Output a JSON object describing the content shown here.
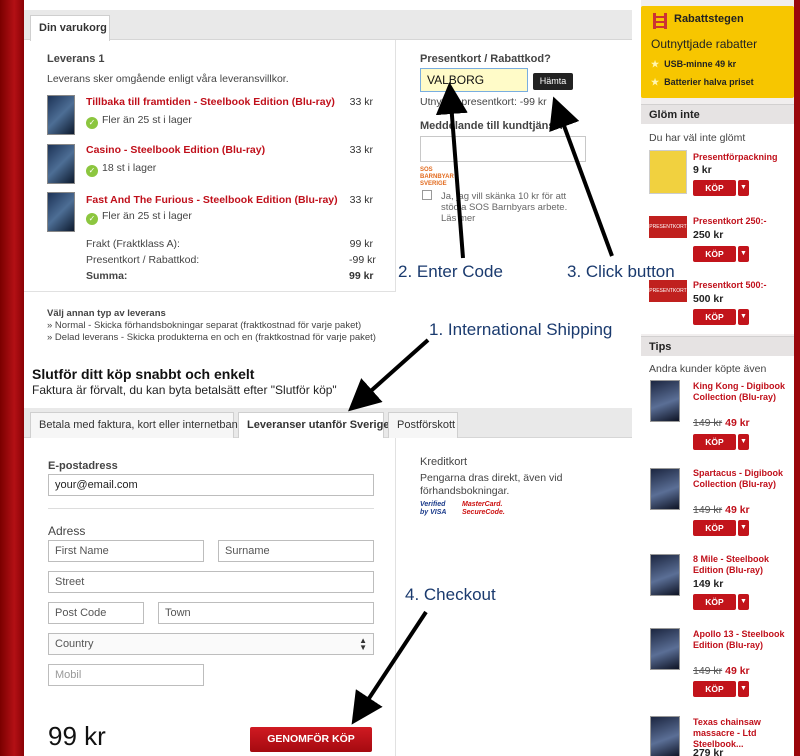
{
  "cart": {
    "tab_label": "Din varukorg",
    "delivery_heading": "Leverans 1",
    "delivery_note": "Leverans sker omgående enligt våra leveransvillkor.",
    "items": [
      {
        "title": "Tillbaka till framtiden - Steelbook Edition (Blu-ray)",
        "stock": "Fler än 25 st i lager",
        "price": "33 kr"
      },
      {
        "title": "Casino - Steelbook Edition (Blu-ray)",
        "stock": "18 st i lager",
        "price": "33 kr"
      },
      {
        "title": "Fast And The Furious - Steelbook Edition (Blu-ray)",
        "stock": "Fler än 25 st i lager",
        "price": "33 kr"
      }
    ],
    "freight_label": "Frakt (Fraktklass A):",
    "freight_value": "99 kr",
    "giftcard_label": "Presentkort / Rabattkod:",
    "giftcard_value": "-99 kr",
    "sum_label": "Summa:",
    "sum_value": "99 kr"
  },
  "delivery_options": {
    "heading": "Välj annan typ av leverans",
    "option1": "» Normal - Skicka förhandsbokningar separat (fraktkostnad för varje paket)",
    "option2": "» Delad leverans - Skicka produkterna en och en (fraktkostnad för varje paket)"
  },
  "discount": {
    "label": "Presentkort / Rabattkod?",
    "code_value": "VALBORG",
    "fetch_label": "Hämta",
    "used_text": "Utnyttjat presentkort: -99 kr",
    "message_label": "Meddelande till kundtjänst?",
    "sos_logo": "SOS BARNBYAR SVERIGE",
    "donate_text_1": "Ja, jag vill skänka 10 kr för att",
    "donate_text_2": "stödja SOS Barnbyars arbete.",
    "donate_text_3": "Läs mer"
  },
  "checkout": {
    "title": "Slutför ditt köp snabbt och enkelt",
    "subtitle": "Faktura är förvalt, du kan byta betalsätt efter \"Slutför köp\"",
    "tabs": [
      "Betala med faktura, kort eller internetbank",
      "Leveranser utanför Sverige",
      "Postförskott"
    ],
    "email_label": "E-postadress",
    "email_value": "your@email.com",
    "address_label": "Adress",
    "first_name": "First Name",
    "surname": "Surname",
    "street": "Street",
    "post_code": "Post Code",
    "town": "Town",
    "country": "Country",
    "mobile": "Mobil",
    "total": "99 kr",
    "button": "GENOMFÖR KÖP"
  },
  "card": {
    "heading": "Kreditkort",
    "text_1": "Pengarna dras direkt, även vid",
    "text_2": "förhandsbokningar.",
    "visa": "Verified by VISA",
    "mastercard": "MasterCard. SecureCode."
  },
  "sidebar": {
    "promo_title": "Rabattstegen",
    "promo_sub": "Outnyttjade rabatter",
    "promo_items": [
      "USB-minne 49 kr",
      "Batterier halva priset"
    ],
    "forget_head": "Glöm inte",
    "forget_sub": "Du har väl inte glömt",
    "forget_items": [
      {
        "name": "Presentförpackning",
        "price": "9 kr",
        "thumb": ""
      },
      {
        "name": "Presentkort 250:-",
        "price": "250 kr",
        "thumb": "PRESENTKORT"
      },
      {
        "name": "Presentkort 500:-",
        "price": "500 kr",
        "thumb": "PRESENTKORT"
      }
    ],
    "tips_head": "Tips",
    "tips_sub": "Andra kunder köpte även",
    "tips_items": [
      {
        "name": "King Kong - Digibook Collection (Blu-ray)",
        "old": "149 kr",
        "price": "49 kr"
      },
      {
        "name": "Spartacus - Digibook Collection (Blu-ray)",
        "old": "149 kr",
        "price": "49 kr"
      },
      {
        "name": "8 Mile - Steelbook Edition (Blu-ray)",
        "old": "",
        "price": "149 kr"
      },
      {
        "name": "Apollo 13 - Steelbook Edition (Blu-ray)",
        "old": "149 kr",
        "price": "49 kr"
      },
      {
        "name": "Texas chainsaw massacre - Ltd Steelbook...",
        "old": "",
        "price": "279 kr"
      }
    ],
    "buy_label": "KÖP",
    "drop_icon": "▼"
  },
  "annotations": {
    "a1": "1. International Shipping",
    "a2": "2. Enter Code",
    "a3": "3. Click button",
    "a4": "4. Checkout"
  },
  "colors": {
    "accent_red": "#c0101b",
    "promo_yellow": "#f7c600",
    "frame_red": "#b31015"
  }
}
